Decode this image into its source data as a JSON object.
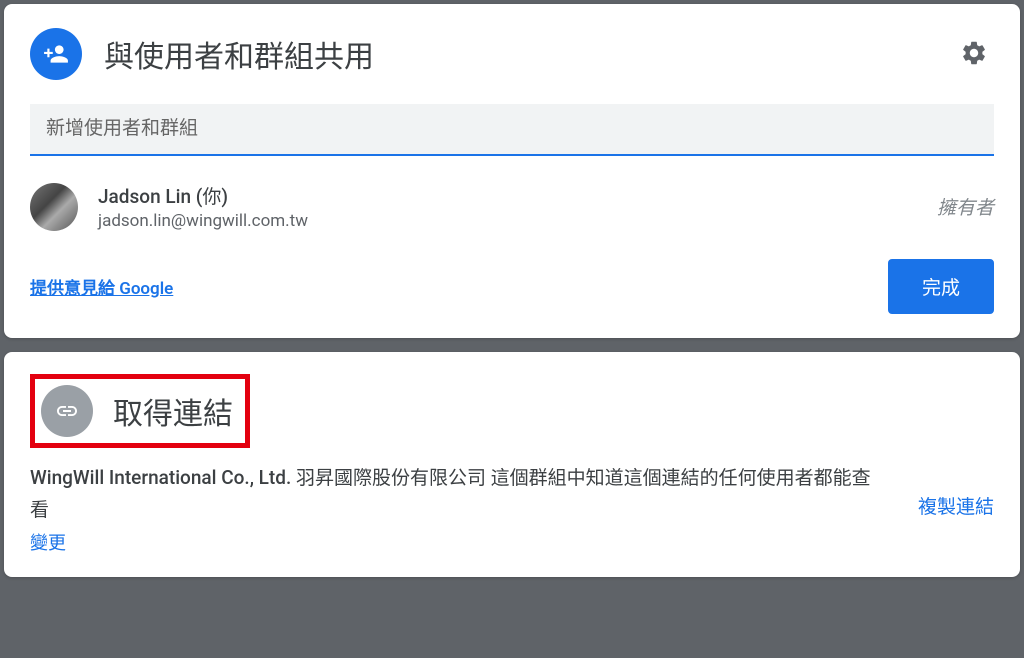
{
  "share": {
    "title": "與使用者和群組共用",
    "inputPlaceholder": "新增使用者和群組",
    "user": {
      "name": "Jadson Lin (你)",
      "email": "jadson.lin@wingwill.com.tw",
      "role": "擁有者"
    },
    "feedbackLabel": "提供意見給 Google",
    "doneLabel": "完成"
  },
  "link": {
    "title": "取得連結",
    "companyName": "WingWill International Co., Ltd. 羽昇國際股份有限公司",
    "descSuffix": " 這個群組中知道這個連結的任何使用者都能查看",
    "copyLabel": "複製連結",
    "changeLabel": "變更"
  }
}
